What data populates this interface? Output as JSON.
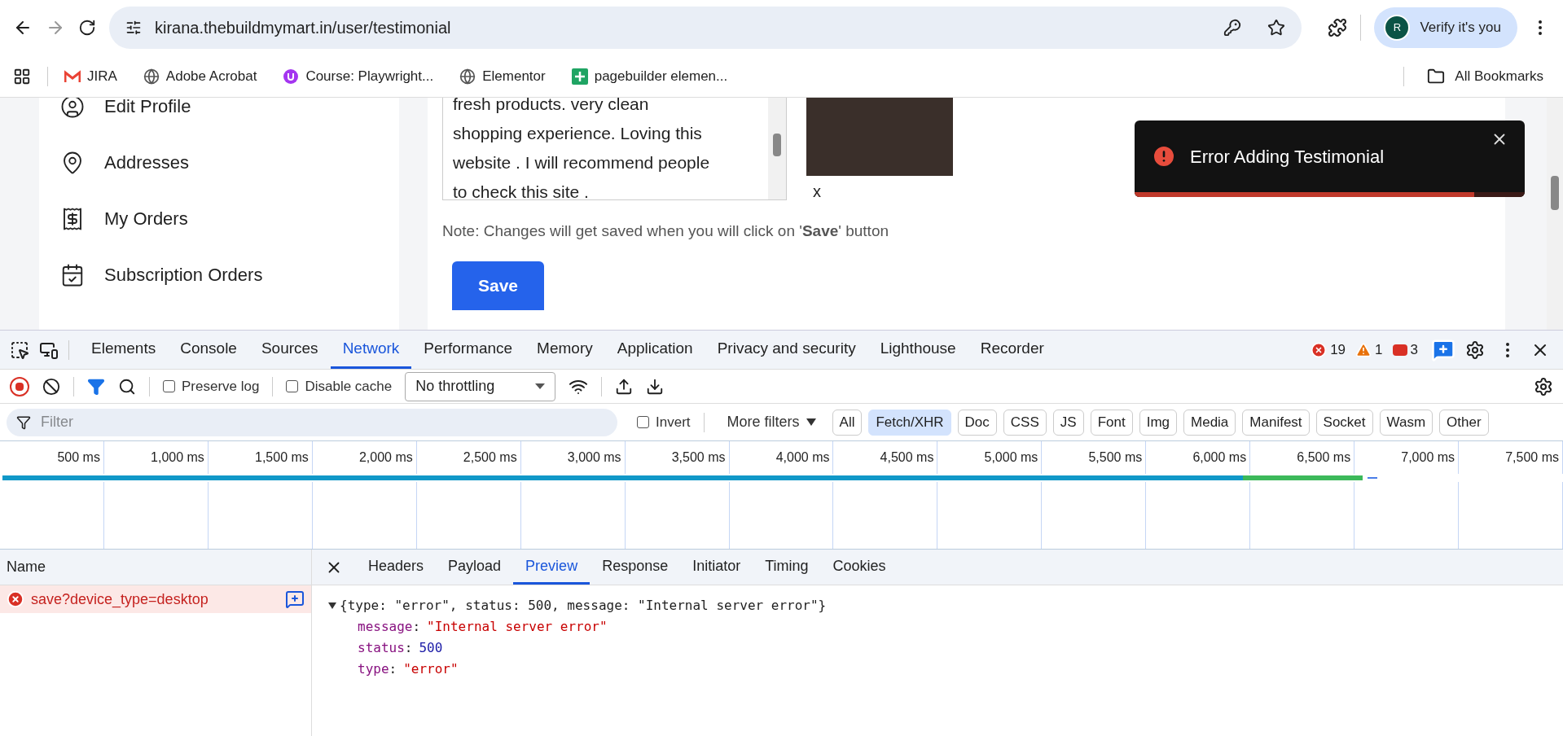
{
  "browser": {
    "url": "kirana.thebuildmymart.in/user/testimonial",
    "profile_button": "Verify it's you",
    "avatar_letter": "R",
    "bookmarks": [
      {
        "label": "JIRA",
        "kind": "mail"
      },
      {
        "label": "Adobe Acrobat",
        "kind": "globe"
      },
      {
        "label": "Course: Playwright...",
        "kind": "course"
      },
      {
        "label": "Elementor",
        "kind": "globe"
      },
      {
        "label": "pagebuilder elemen...",
        "kind": "sheet"
      }
    ],
    "all_bookmarks": "All Bookmarks"
  },
  "page": {
    "sidebar": {
      "items": [
        {
          "label": "Edit Profile",
          "kind": "profile"
        },
        {
          "label": "Addresses",
          "kind": "pin"
        },
        {
          "label": "My Orders",
          "kind": "receipt"
        },
        {
          "label": "Subscription Orders",
          "kind": "calendar"
        }
      ]
    },
    "testimonial_lines": [
      "fresh products. very clean",
      "shopping experience. Loving this",
      "website . I will recommend people",
      "to check this site ."
    ],
    "remove_image": "x",
    "note": "Note: Changes will get saved when you will click on '**Save**' button",
    "save_button": "Save",
    "toast": {
      "message": "Error Adding Testimonial",
      "level": 0.87
    }
  },
  "devtools": {
    "tabs": [
      {
        "label": "Elements",
        "selected": false
      },
      {
        "label": "Console",
        "selected": false
      },
      {
        "label": "Sources",
        "selected": false
      },
      {
        "label": "Network",
        "selected": true
      },
      {
        "label": "Performance",
        "selected": false
      },
      {
        "label": "Memory",
        "selected": false
      },
      {
        "label": "Application",
        "selected": false
      },
      {
        "label": "Privacy and security",
        "selected": false
      },
      {
        "label": "Lighthouse",
        "selected": false
      },
      {
        "label": "Recorder",
        "selected": false
      }
    ],
    "counts": {
      "errors": "19",
      "warnings": "1",
      "issues": "3"
    },
    "toolbar": {
      "recording": true,
      "preserve_log": {
        "label": "Preserve log",
        "checked": false
      },
      "disable_cache": {
        "label": "Disable cache",
        "checked": false
      },
      "throttling": "No throttling"
    },
    "filter": {
      "placeholder": "Filter",
      "invert": {
        "label": "Invert",
        "checked": false
      },
      "more_filters": "More filters",
      "types": [
        {
          "label": "All",
          "selected": false
        },
        {
          "label": "Fetch/XHR",
          "selected": true
        },
        {
          "label": "Doc",
          "selected": false
        },
        {
          "label": "CSS",
          "selected": false
        },
        {
          "label": "JS",
          "selected": false
        },
        {
          "label": "Font",
          "selected": false
        },
        {
          "label": "Img",
          "selected": false
        },
        {
          "label": "Media",
          "selected": false
        },
        {
          "label": "Manifest",
          "selected": false
        },
        {
          "label": "Socket",
          "selected": false
        },
        {
          "label": "Wasm",
          "selected": false
        },
        {
          "label": "Other",
          "selected": false
        }
      ]
    },
    "timeline_ticks": [
      "500 ms",
      "1,000 ms",
      "1,500 ms",
      "2,000 ms",
      "2,500 ms",
      "3,000 ms",
      "3,500 ms",
      "4,000 ms",
      "4,500 ms",
      "5,000 ms",
      "5,500 ms",
      "6,000 ms",
      "6,500 ms",
      "7,000 ms",
      "7,500 ms"
    ],
    "name_column": "Name",
    "requests": [
      {
        "name": "save?device_type=desktop",
        "failed": true,
        "selected": true
      }
    ],
    "detail_tabs": [
      {
        "label": "Headers",
        "selected": false
      },
      {
        "label": "Payload",
        "selected": false
      },
      {
        "label": "Preview",
        "selected": true
      },
      {
        "label": "Response",
        "selected": false
      },
      {
        "label": "Initiator",
        "selected": false
      },
      {
        "label": "Timing",
        "selected": false
      },
      {
        "label": "Cookies",
        "selected": false
      }
    ],
    "preview": {
      "summary": "{type: \"error\", status: 500, message: \"Internal server error\"}",
      "expanded": true,
      "properties": [
        {
          "key": "message",
          "separator": ":",
          "value": "\"Internal server error\"",
          "kind": "string"
        },
        {
          "key": "status",
          "separator": ":",
          "value": "500",
          "kind": "number"
        },
        {
          "key": "type",
          "separator": ":",
          "value": "\"error\"",
          "kind": "string"
        }
      ]
    }
  }
}
